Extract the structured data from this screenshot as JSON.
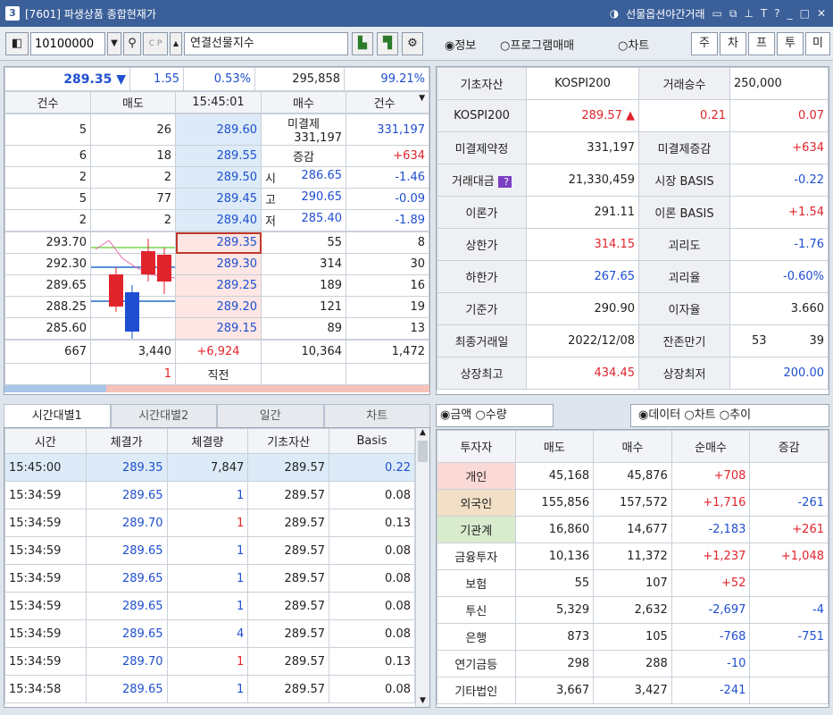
{
  "window": {
    "number": "3",
    "title": "[7601] 파생상품 종합현재가",
    "right_label": "선물옵션야간거래"
  },
  "toolbar": {
    "code": "10100000",
    "name": "연결선물지수",
    "radio1": "◉정보",
    "radio2": "○프로그램매매",
    "radio3": "○차트",
    "btns": [
      "주",
      "차",
      "프",
      "투",
      "미"
    ]
  },
  "quote": {
    "price": "289.35",
    "arrow": "▼",
    "change": "1.55",
    "pct": "0.53%",
    "volume": "295,858",
    "ratio": "99.21%"
  },
  "ob_head": [
    "건수",
    "매도",
    "15:45:01",
    "매수",
    "건수"
  ],
  "ask_rows": [
    {
      "cnt": "5",
      "qty": "26",
      "price": "289.60",
      "label": "미결제",
      "val": "331,197",
      "chg": ""
    },
    {
      "cnt": "6",
      "qty": "18",
      "price": "289.55",
      "label": "증감",
      "val": "",
      "chg": "+634"
    },
    {
      "cnt": "2",
      "qty": "2",
      "price": "289.50",
      "label": "시",
      "val": "286.65",
      "chg": "-1.46"
    },
    {
      "cnt": "5",
      "qty": "77",
      "price": "289.45",
      "label": "고",
      "val": "290.65",
      "chg": "-0.09"
    },
    {
      "cnt": "2",
      "qty": "2",
      "price": "289.40",
      "label": "저",
      "val": "285.40",
      "chg": "-1.89"
    }
  ],
  "bid_rows": [
    {
      "left": "293.70",
      "price": "289.35",
      "qty": "55",
      "cnt": "8"
    },
    {
      "left": "292.30",
      "price": "289.30",
      "qty": "314",
      "cnt": "30"
    },
    {
      "left": "289.65",
      "price": "289.25",
      "qty": "189",
      "cnt": "16"
    },
    {
      "left": "288.25",
      "price": "289.20",
      "qty": "121",
      "cnt": "19"
    },
    {
      "left": "285.60",
      "price": "289.15",
      "qty": "89",
      "cnt": "13"
    }
  ],
  "ob_total": {
    "ask_cnt": "667",
    "ask_qty": "3,440",
    "diff": "+6,924",
    "bid_qty": "10,364",
    "bid_cnt": "1,472"
  },
  "ob_last": {
    "left": "1",
    "label": "직전"
  },
  "info": [
    [
      "기초자산",
      "KOSPI200",
      "거래승수",
      "250,000"
    ],
    [
      "KOSPI200",
      "289.57 ▲",
      "0.21",
      "0.07"
    ],
    [
      "미결제약정",
      "331,197",
      "미결제증감",
      "+634"
    ],
    [
      "거래대금",
      "21,330,459",
      "시장 BASIS",
      "-0.22"
    ],
    [
      "이론가",
      "291.11",
      "이론 BASIS",
      "+1.54"
    ],
    [
      "상한가",
      "314.15",
      "괴리도",
      "-1.76"
    ],
    [
      "하한가",
      "267.65",
      "괴리율",
      "-0.60%"
    ],
    [
      "기준가",
      "290.90",
      "이자율",
      "3.660"
    ],
    [
      "최종거래일",
      "2022/12/08",
      "잔존만기",
      "53"
    ],
    [
      "상장최고",
      "434.45",
      "상장최저",
      "200.00"
    ]
  ],
  "info_extra": "39",
  "tabs": [
    "시간대별1",
    "시간대별2",
    "일간",
    "차트"
  ],
  "trade_head": [
    "시간",
    "체결가",
    "체결량",
    "기초자산",
    "Basis"
  ],
  "trades": [
    [
      "15:45:00",
      "289.35",
      "7,847",
      "289.57",
      "0.22"
    ],
    [
      "15:34:59",
      "289.65",
      "1",
      "289.57",
      "0.08"
    ],
    [
      "15:34:59",
      "289.70",
      "1",
      "289.57",
      "0.13"
    ],
    [
      "15:34:59",
      "289.65",
      "1",
      "289.57",
      "0.08"
    ],
    [
      "15:34:59",
      "289.65",
      "1",
      "289.57",
      "0.08"
    ],
    [
      "15:34:59",
      "289.65",
      "1",
      "289.57",
      "0.08"
    ],
    [
      "15:34:59",
      "289.65",
      "4",
      "289.57",
      "0.08"
    ],
    [
      "15:34:59",
      "289.70",
      "1",
      "289.57",
      "0.13"
    ],
    [
      "15:34:58",
      "289.65",
      "1",
      "289.57",
      "0.08"
    ]
  ],
  "inv_opts": {
    "a": "◉금액",
    "b": "○수량",
    "c": "◉데이터",
    "d": "○차트",
    "e": "○추이"
  },
  "inv_head": [
    "투자자",
    "매도",
    "매수",
    "순매수",
    "증감"
  ],
  "investors": [
    [
      "개인",
      "45,168",
      "45,876",
      "+708",
      ""
    ],
    [
      "외국인",
      "155,856",
      "157,572",
      "+1,716",
      "-261"
    ],
    [
      "기관계",
      "16,860",
      "14,677",
      "-2,183",
      "+261"
    ],
    [
      "금융투자",
      "10,136",
      "11,372",
      "+1,237",
      "+1,048"
    ],
    [
      "보험",
      "55",
      "107",
      "+52",
      ""
    ],
    [
      "투신",
      "5,329",
      "2,632",
      "-2,697",
      "-4"
    ],
    [
      "은행",
      "873",
      "105",
      "-768",
      "-751"
    ],
    [
      "연기금등",
      "298",
      "288",
      "-10",
      ""
    ],
    [
      "기타법인",
      "3,667",
      "3,427",
      "-241",
      ""
    ]
  ],
  "colors": {
    "up": "#e0242c",
    "down": "#1f4fd0",
    "title": "#3b5f99"
  }
}
